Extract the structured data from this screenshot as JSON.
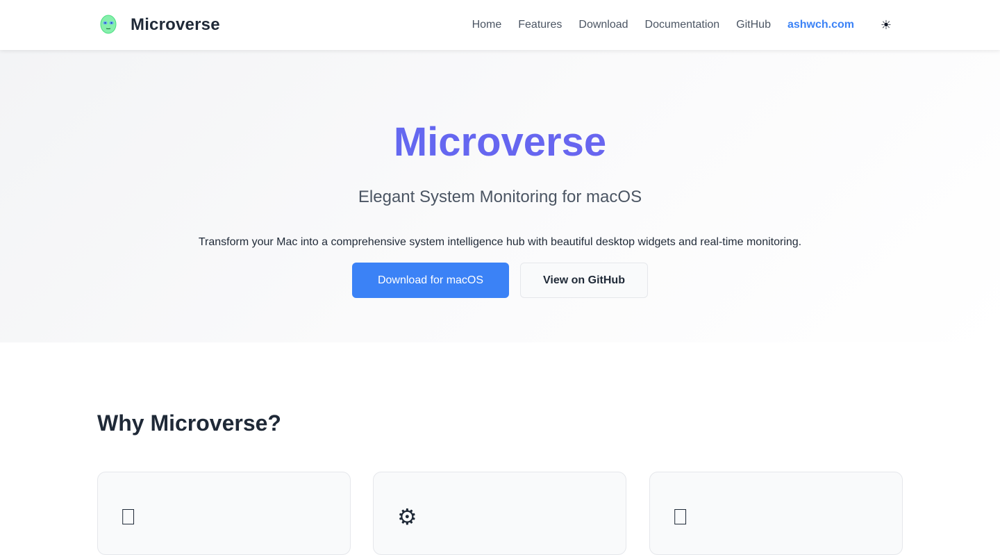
{
  "header": {
    "brand_name": "Microverse",
    "logo_icon": "alien-face-icon",
    "nav": [
      {
        "label": "Home"
      },
      {
        "label": "Features"
      },
      {
        "label": "Download"
      },
      {
        "label": "Documentation"
      },
      {
        "label": "GitHub"
      },
      {
        "label": "ashwch.com"
      }
    ],
    "theme_toggle_glyph": "☀",
    "accent_color": "#3b82f6"
  },
  "hero": {
    "title": "Microverse",
    "subtitle": "Elegant System Monitoring for macOS",
    "description": "Transform your Mac into a comprehensive system intelligence hub with beautiful desktop widgets and real-time monitoring.",
    "primary_button": "Download for macOS",
    "secondary_button": "View on GitHub",
    "title_color": "#6366f1"
  },
  "features": {
    "title": "Why Microverse?",
    "cards": [
      {
        "icon_glyph": "⎕",
        "icon": "missing-glyph-icon"
      },
      {
        "icon_glyph": "⚙",
        "icon": "gear-icon"
      },
      {
        "icon_glyph": "⎕",
        "icon": "missing-glyph-icon"
      }
    ]
  }
}
